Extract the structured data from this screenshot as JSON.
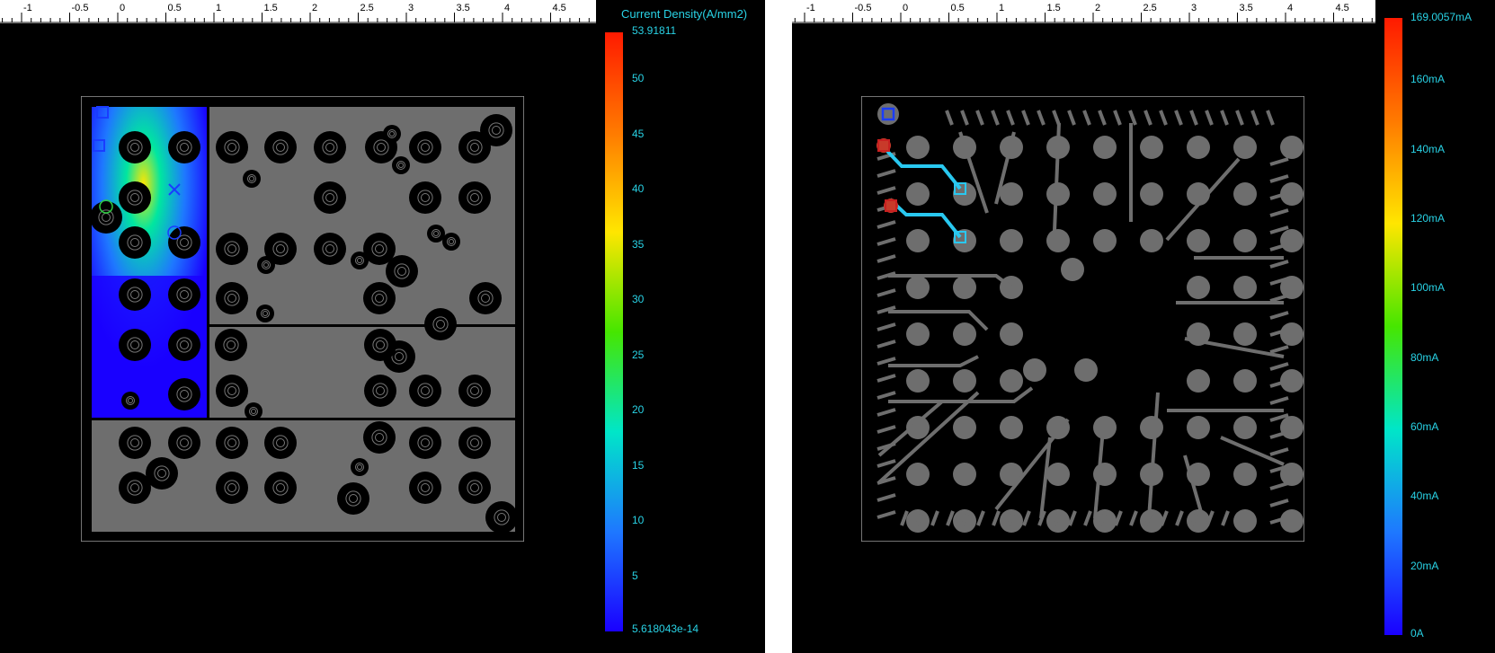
{
  "ruler": {
    "labels": [
      "-1",
      "-0.5",
      "0",
      "0.5",
      "1",
      "1.5",
      "2",
      "2.5",
      "3",
      "3.5",
      "4",
      "4.5"
    ]
  },
  "left_view": {
    "legend_title": "Current Density(A/mm2)",
    "legend_max": "53.91811",
    "legend_min": "5.618043e-14",
    "legend_ticks": [
      "50",
      "45",
      "40",
      "35",
      "30",
      "25",
      "20",
      "15",
      "10",
      "5"
    ],
    "plane_color": "#6e6e6e",
    "via_color": "#000000"
  },
  "right_view": {
    "legend_max": "169.0057mA",
    "legend_min": "0A",
    "legend_ticks": [
      "160mA",
      "140mA",
      "120mA",
      "100mA",
      "80mA",
      "60mA",
      "40mA",
      "20mA"
    ],
    "trace_color": "#6e6e6e",
    "highlight_color": "#29c8f0"
  },
  "colors": {
    "background": "#000000",
    "label": "#29d3e6",
    "colorbar_stops": [
      "#ff1a00",
      "#ff7a00",
      "#ffe600",
      "#46e600",
      "#00e6c8",
      "#1e78ff",
      "#1a00ff"
    ]
  }
}
